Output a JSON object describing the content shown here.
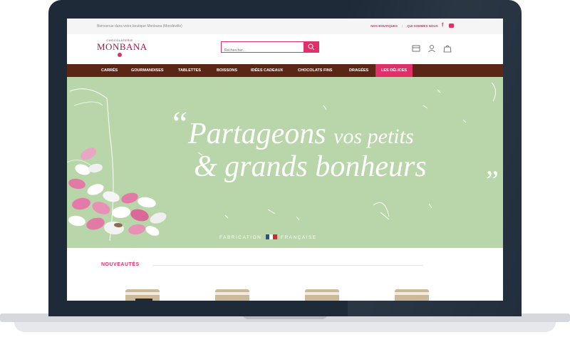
{
  "topbar": {
    "welcome": "Bienvenue dans votre boutique Monbana (Mondeville)",
    "links": [
      "NOS BOUTIQUES",
      "QUI SOMMES NOUS"
    ],
    "social": [
      "facebook-icon",
      "youtube-icon"
    ]
  },
  "header": {
    "logo": {
      "small": "CHOCOLATERIE",
      "big": "MONBANA"
    },
    "search": {
      "placeholder": "Rechercher..."
    },
    "icons": [
      "store-icon",
      "user-icon",
      "bag-icon"
    ]
  },
  "nav": {
    "items": [
      {
        "label": "CARRÉS"
      },
      {
        "label": "GOURMANDISES"
      },
      {
        "label": "TABLETTES"
      },
      {
        "label": "BOISSONS"
      },
      {
        "label": "IDÉES CADEAUX"
      },
      {
        "label": "CHOCOLATS FINS"
      },
      {
        "label": "DRAGÉES"
      },
      {
        "label": "LES DÉLICES"
      }
    ],
    "active": "LES DÉLICES"
  },
  "hero": {
    "line1_a": "Partageons",
    "line1_b": "vos petits",
    "line2": "& grands bonheurs",
    "quote_open": "“",
    "quote_close": "”",
    "made_in_a": "FABRICATION",
    "made_in_b": "FRANÇAISE",
    "bg": "#b9d5aa"
  },
  "section": {
    "title": "NOUVEAUTÉS"
  },
  "colors": {
    "accent": "#e0306a",
    "nav": "#5b2615",
    "brand": "#a01a44"
  }
}
